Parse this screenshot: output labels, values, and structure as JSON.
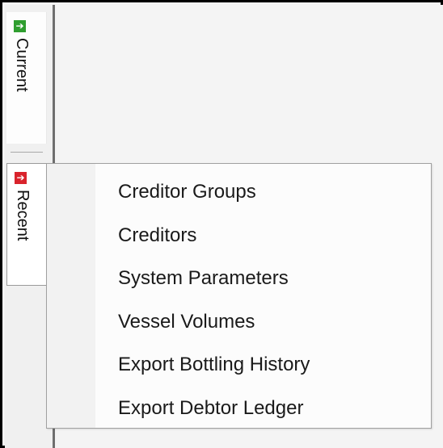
{
  "tabs": [
    {
      "label": "Current",
      "icon": "green-arrow-right-icon",
      "icon_color": "#2f9e2f"
    },
    {
      "label": "Recent",
      "icon": "red-arrow-right-icon",
      "icon_color": "#d9232c"
    }
  ],
  "menu": {
    "items": [
      {
        "label": "Creditor Groups"
      },
      {
        "label": "Creditors"
      },
      {
        "label": "System Parameters"
      },
      {
        "label": "Vessel Volumes"
      },
      {
        "label": "Export Bottling History"
      },
      {
        "label": "Export Debtor Ledger"
      }
    ]
  }
}
